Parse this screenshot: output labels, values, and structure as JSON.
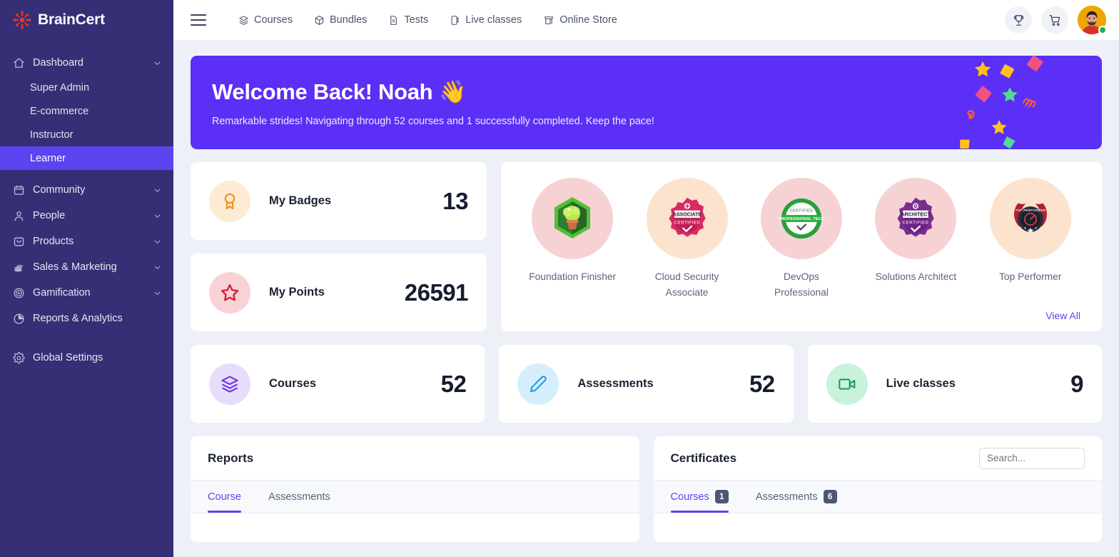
{
  "brand": {
    "name": "BrainCert",
    "logo_icon": "braincert-snowflake-logo"
  },
  "sidebar": {
    "items": [
      {
        "label": "Dashboard",
        "icon": "home-icon",
        "expandable": true
      },
      {
        "label": "Community",
        "icon": "calendar-icon",
        "expandable": true
      },
      {
        "label": "People",
        "icon": "person-icon",
        "expandable": true
      },
      {
        "label": "Products",
        "icon": "bag-icon",
        "expandable": true
      },
      {
        "label": "Sales & Marketing",
        "icon": "coins-icon",
        "expandable": true
      },
      {
        "label": "Gamification",
        "icon": "target-icon",
        "expandable": true
      },
      {
        "label": "Reports & Analytics",
        "icon": "pie-chart-icon",
        "expandable": false
      },
      {
        "label": "Global Settings",
        "icon": "gear-icon",
        "expandable": false
      }
    ],
    "dashboard_subitems": [
      {
        "label": "Super Admin",
        "active": false
      },
      {
        "label": "E-commerce",
        "active": false
      },
      {
        "label": "Instructor",
        "active": false
      },
      {
        "label": "Learner",
        "active": true
      }
    ],
    "active_color": "#5b44f0",
    "background_color": "#352f75"
  },
  "topbar": {
    "menu_icon": "hamburger-icon",
    "nav": [
      {
        "label": "Courses",
        "icon": "layers-icon"
      },
      {
        "label": "Bundles",
        "icon": "box-icon"
      },
      {
        "label": "Tests",
        "icon": "file-icon"
      },
      {
        "label": "Live classes",
        "icon": "mobile-video-icon"
      },
      {
        "label": "Online Store",
        "icon": "store-icon"
      }
    ],
    "trophy_icon": "trophy-icon",
    "cart_icon": "cart-icon",
    "avatar": "user-avatar",
    "presence": "online"
  },
  "banner": {
    "title": "Welcome Back! Noah",
    "emoji": "👋",
    "subtitle": "Remarkable strides! Navigating through 52 courses and 1 successfully completed. Keep the pace!",
    "background_color": "#5b2ff5"
  },
  "stats": {
    "badges": {
      "label": "My Badges",
      "value": "13",
      "icon": "award-ribbon-icon",
      "icon_color": "#f59222",
      "circle_color": "#fdecd4"
    },
    "points": {
      "label": "My Points",
      "value": "26591",
      "icon": "star-outline-icon",
      "icon_color": "#d61f34",
      "circle_color": "#f8d2d6"
    },
    "courses": {
      "label": "Courses",
      "value": "52",
      "icon": "layers-stack-icon",
      "icon_color": "#6d31e8",
      "circle_color": "#e7ddfb"
    },
    "assessments": {
      "label": "Assessments",
      "value": "52",
      "icon": "pencil-icon",
      "icon_color": "#1e9ae8",
      "circle_color": "#d6eefc"
    },
    "live_classes": {
      "label": "Live classes",
      "value": "9",
      "icon": "video-camera-icon",
      "icon_color": "#1f9d55",
      "circle_color": "#c9f2da"
    }
  },
  "badges_panel": {
    "view_all_label": "View All",
    "items": [
      {
        "name": "Foundation Finisher",
        "circle_color": "#f6d2d4",
        "icon": "plant-hexagon-badge-icon"
      },
      {
        "name": "Cloud Security Associate",
        "circle_color": "#fbe3ce",
        "icon": "associate-certified-badge-icon"
      },
      {
        "name": "DevOps Professional",
        "circle_color": "#f6d2d4",
        "icon": "professional-tech-certified-badge-icon"
      },
      {
        "name": "Solutions Architect",
        "circle_color": "#f6d2d4",
        "icon": "architect-certified-badge-icon"
      },
      {
        "name": "Top Performer",
        "circle_color": "#fbe3ce",
        "icon": "top-performer-laurel-badge-icon"
      }
    ]
  },
  "reports_panel": {
    "title": "Reports",
    "tabs": [
      {
        "label": "Course",
        "active": true
      },
      {
        "label": "Assessments",
        "active": false
      }
    ]
  },
  "certificates_panel": {
    "title": "Certificates",
    "search_placeholder": "Search...",
    "search_value": "",
    "tabs": [
      {
        "label": "Courses",
        "count": "1",
        "active": true
      },
      {
        "label": "Assessments",
        "count": "6",
        "active": false
      }
    ]
  }
}
